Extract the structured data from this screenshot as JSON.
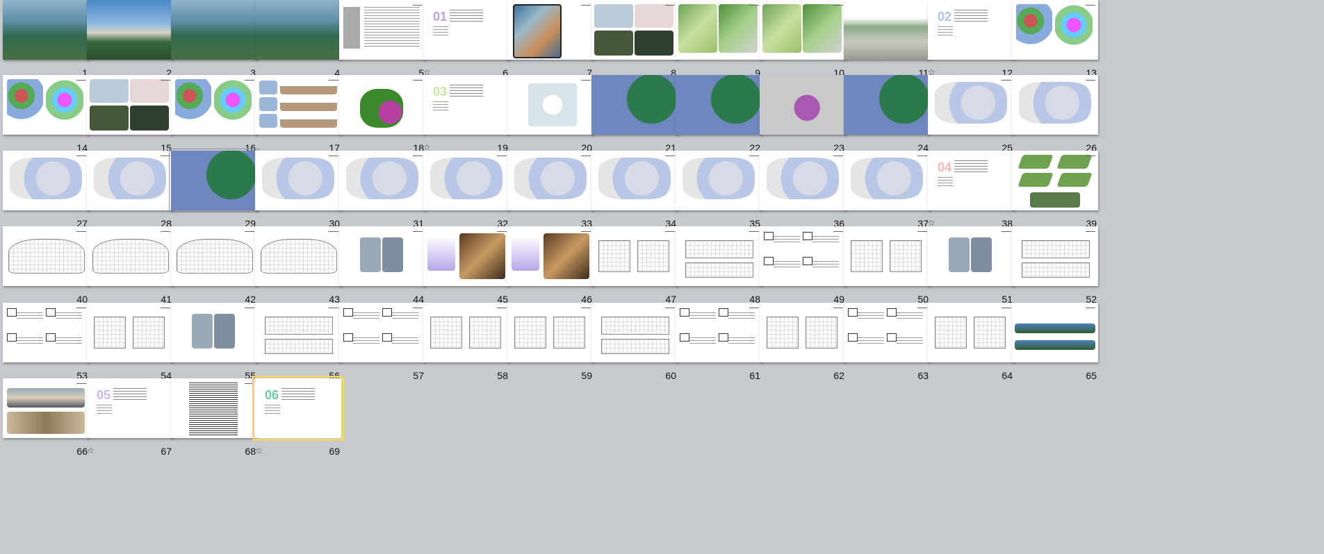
{
  "view": "slide-sorter",
  "colors": {
    "background": "#c6c9ce",
    "selection": "#f0d46a",
    "slide": "#ffffff"
  },
  "selected_slide": "69",
  "hover_slide": "29",
  "star_glyph": "☆",
  "slides": [
    {
      "n": "1",
      "kind": "aerial-lake"
    },
    {
      "n": "2",
      "kind": "building-photo"
    },
    {
      "n": "3",
      "kind": "aerial-lake"
    },
    {
      "n": "4",
      "kind": "aerial-lake"
    },
    {
      "n": "5",
      "kind": "text-table"
    },
    {
      "n": "6",
      "kind": "section",
      "sec": "01",
      "star": true
    },
    {
      "n": "7",
      "kind": "collage"
    },
    {
      "n": "8",
      "kind": "maps"
    },
    {
      "n": "9",
      "kind": "maps-green"
    },
    {
      "n": "10",
      "kind": "maps-green"
    },
    {
      "n": "11",
      "kind": "street"
    },
    {
      "n": "12",
      "kind": "section",
      "sec": "02",
      "star": true
    },
    {
      "n": "13",
      "kind": "maps-color"
    },
    {
      "n": "14",
      "kind": "maps-color"
    },
    {
      "n": "15",
      "kind": "maps"
    },
    {
      "n": "16",
      "kind": "maps-color"
    },
    {
      "n": "17",
      "kind": "sections"
    },
    {
      "n": "18",
      "kind": "green-blob"
    },
    {
      "n": "19",
      "kind": "section",
      "sec": "03",
      "star": true
    },
    {
      "n": "20",
      "kind": "route"
    },
    {
      "n": "21",
      "kind": "blue-map"
    },
    {
      "n": "22",
      "kind": "blue-map"
    },
    {
      "n": "23",
      "kind": "grey-map"
    },
    {
      "n": "24",
      "kind": "blue-map"
    },
    {
      "n": "25",
      "kind": "site-plan"
    },
    {
      "n": "26",
      "kind": "site-plan"
    },
    {
      "n": "27",
      "kind": "site-plan"
    },
    {
      "n": "28",
      "kind": "site-plan"
    },
    {
      "n": "29",
      "kind": "blue-map"
    },
    {
      "n": "30",
      "kind": "site-plan"
    },
    {
      "n": "31",
      "kind": "site-plan"
    },
    {
      "n": "32",
      "kind": "site-plan"
    },
    {
      "n": "33",
      "kind": "site-plan"
    },
    {
      "n": "34",
      "kind": "site-plan"
    },
    {
      "n": "35",
      "kind": "site-plan"
    },
    {
      "n": "36",
      "kind": "site-plan"
    },
    {
      "n": "37",
      "kind": "site-plan"
    },
    {
      "n": "38",
      "kind": "section",
      "sec": "04",
      "star": true
    },
    {
      "n": "39",
      "kind": "models"
    },
    {
      "n": "40",
      "kind": "floor-plan"
    },
    {
      "n": "41",
      "kind": "floor-plan"
    },
    {
      "n": "42",
      "kind": "floor-plan"
    },
    {
      "n": "43",
      "kind": "floor-plan"
    },
    {
      "n": "44",
      "kind": "massing"
    },
    {
      "n": "45",
      "kind": "interiors"
    },
    {
      "n": "46",
      "kind": "interiors"
    },
    {
      "n": "47",
      "kind": "plans-small"
    },
    {
      "n": "48",
      "kind": "elevation"
    },
    {
      "n": "49",
      "kind": "boxes"
    },
    {
      "n": "50",
      "kind": "plans-small"
    },
    {
      "n": "51",
      "kind": "massing"
    },
    {
      "n": "52",
      "kind": "elevation"
    },
    {
      "n": "53",
      "kind": "boxes"
    },
    {
      "n": "54",
      "kind": "plans-small"
    },
    {
      "n": "55",
      "kind": "massing"
    },
    {
      "n": "56",
      "kind": "elevation"
    },
    {
      "n": "57",
      "kind": "boxes"
    },
    {
      "n": "58",
      "kind": "plans-small"
    },
    {
      "n": "59",
      "kind": "plans-small"
    },
    {
      "n": "60",
      "kind": "elevation"
    },
    {
      "n": "61",
      "kind": "boxes"
    },
    {
      "n": "62",
      "kind": "plans-small"
    },
    {
      "n": "63",
      "kind": "boxes"
    },
    {
      "n": "64",
      "kind": "plans-small"
    },
    {
      "n": "65",
      "kind": "panorama"
    },
    {
      "n": "66",
      "kind": "villa"
    },
    {
      "n": "67",
      "kind": "section",
      "sec": "05",
      "star": true
    },
    {
      "n": "68",
      "kind": "spreadsheet"
    },
    {
      "n": "69",
      "kind": "section",
      "sec": "06",
      "star": true
    }
  ]
}
